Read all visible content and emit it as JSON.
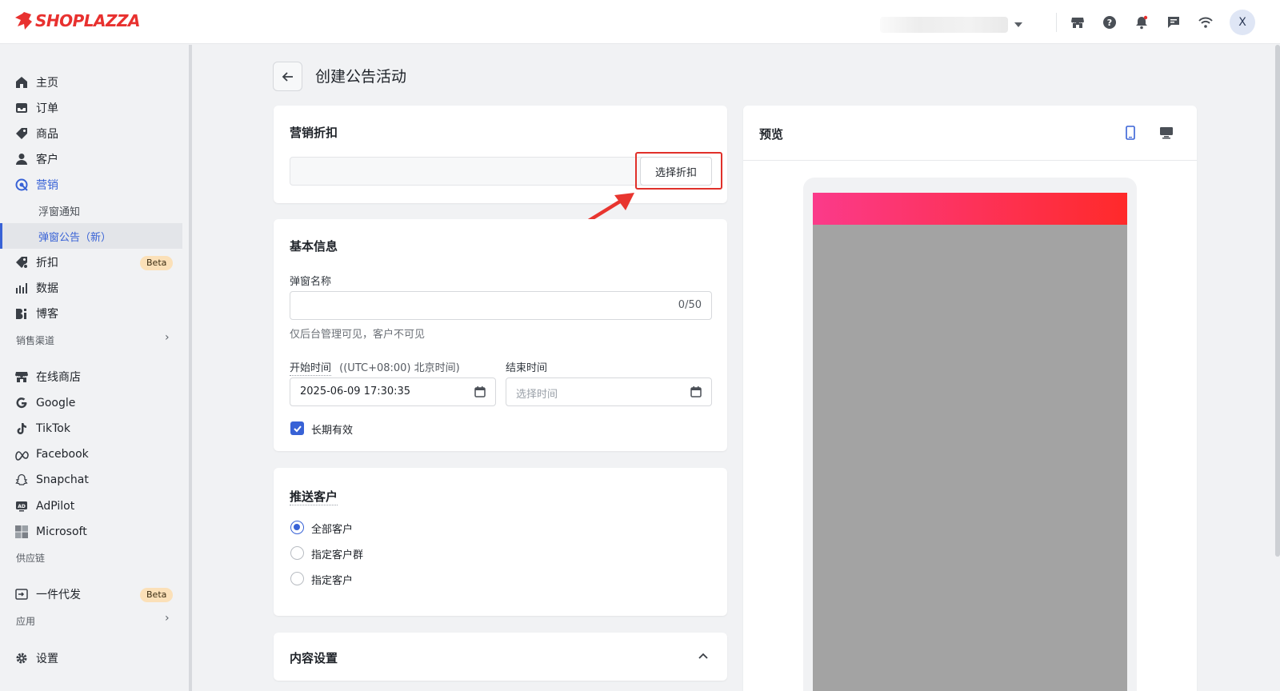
{
  "brand": {
    "name": "SHOPLAZZA",
    "color": "#e8312f"
  },
  "accent": "#3862d6",
  "header": {
    "avatar_initial": "X"
  },
  "sidebar": {
    "main": [
      {
        "label": "主页",
        "icon": "home-icon"
      },
      {
        "label": "订单",
        "icon": "inbox-icon"
      },
      {
        "label": "商品",
        "icon": "tag-icon"
      },
      {
        "label": "客户",
        "icon": "user-icon"
      },
      {
        "label": "营销",
        "icon": "target-icon"
      }
    ],
    "marketing_sub": [
      {
        "label": "浮窗通知"
      },
      {
        "label": "弹窗公告（新）"
      }
    ],
    "after": [
      {
        "label": "折扣",
        "icon": "discount-icon",
        "badge": "Beta"
      },
      {
        "label": "数据",
        "icon": "bar-chart-icon"
      },
      {
        "label": "博客",
        "icon": "blog-icon"
      }
    ],
    "sales_channels_label": "销售渠道",
    "channels": [
      {
        "label": "在线商店",
        "icon": "store-icon"
      },
      {
        "label": "Google",
        "icon": "google-icon"
      },
      {
        "label": "TikTok",
        "icon": "tiktok-icon"
      },
      {
        "label": "Facebook",
        "icon": "meta-icon"
      },
      {
        "label": "Snapchat",
        "icon": "snapchat-icon"
      },
      {
        "label": "AdPilot",
        "icon": "adpilot-icon"
      },
      {
        "label": "Microsoft",
        "icon": "microsoft-icon"
      }
    ],
    "supply_chain_label": "供应链",
    "supply": [
      {
        "label": "一件代发",
        "icon": "dropship-icon",
        "badge": "Beta"
      }
    ],
    "apps_label": "应用",
    "settings": {
      "label": "设置",
      "icon": "gear-icon"
    }
  },
  "page": {
    "title": "创建公告活动"
  },
  "discount_card": {
    "title": "营销折扣",
    "button": "选择折扣"
  },
  "basic_info": {
    "title": "基本信息",
    "name_label": "弹窗名称",
    "name_counter": "0/50",
    "name_hint": "仅后台管理可见，客户不可见",
    "start_label": "开始时间",
    "start_tz": "((UTC+08:00) 北京时间)",
    "start_value": "2025-06-09 17:30:35",
    "end_label": "结束时间",
    "end_placeholder": "选择时间",
    "long_term": "长期有效"
  },
  "push_card": {
    "title": "推送客户",
    "options": [
      {
        "label": "全部客户",
        "checked": true
      },
      {
        "label": "指定客户群"
      },
      {
        "label": "指定客户"
      }
    ]
  },
  "content_card": {
    "title": "内容设置"
  },
  "preview": {
    "title": "预览",
    "banner_gradient": [
      "#fb3a8a",
      "#ff2a2a"
    ]
  }
}
